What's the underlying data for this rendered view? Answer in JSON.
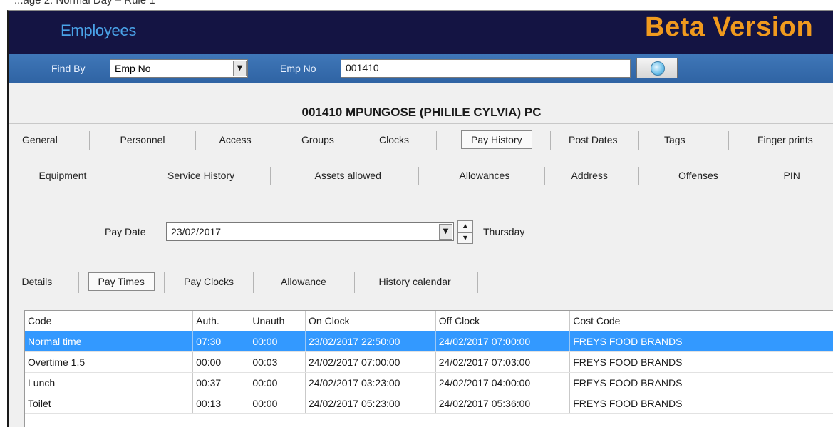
{
  "caption": "...age 2: Normal Day – Rule 1",
  "header": {
    "title": "Employees",
    "badge": "Beta Version"
  },
  "findbar": {
    "find_by_label": "Find By",
    "find_by_value": "Emp No",
    "emp_no_label": "Emp No",
    "emp_no_value": "001410"
  },
  "employee_title": "001410 MPUNGOSE (PHILILE CYLVIA) PC",
  "tabs_row1": [
    "General",
    "Personnel",
    "Access",
    "Groups",
    "Clocks",
    "Pay History",
    "Post Dates",
    "Tags",
    "Finger prints"
  ],
  "tabs_row2": [
    "Equipment",
    "Service History",
    "Assets allowed",
    "Allowances",
    "Address",
    "Offenses",
    "PIN"
  ],
  "active_tab": "Pay History",
  "pay_date": {
    "label": "Pay Date",
    "value": "23/02/2017",
    "day": "Thursday"
  },
  "subtabs": [
    "Details",
    "Pay Times",
    "Pay Clocks",
    "Allowance",
    "History calendar"
  ],
  "active_subtab": "Pay Times",
  "grid": {
    "columns": [
      "Code",
      "Auth.",
      "Unauth",
      "On Clock",
      "Off Clock",
      "Cost Code"
    ],
    "rows": [
      [
        "Normal time",
        "07:30",
        "00:00",
        "23/02/2017 22:50:00",
        "24/02/2017 07:00:00",
        "FREYS FOOD BRANDS"
      ],
      [
        "Overtime 1.5",
        "00:00",
        "00:03",
        "24/02/2017 07:00:00",
        "24/02/2017 07:03:00",
        "FREYS FOOD BRANDS"
      ],
      [
        "Lunch",
        "00:37",
        "00:00",
        "24/02/2017 03:23:00",
        "24/02/2017 04:00:00",
        "FREYS FOOD BRANDS"
      ],
      [
        "Toilet",
        "00:13",
        "00:00",
        "24/02/2017 05:23:00",
        "24/02/2017 05:36:00",
        "FREYS FOOD BRANDS"
      ]
    ],
    "selected_row": 0
  },
  "colors": {
    "header_bg": "#141443",
    "title_blue": "#4aa3e8",
    "badge_orange": "#f09a1e",
    "findbar_bg": "#3a70b1",
    "selection": "#3399ff"
  }
}
